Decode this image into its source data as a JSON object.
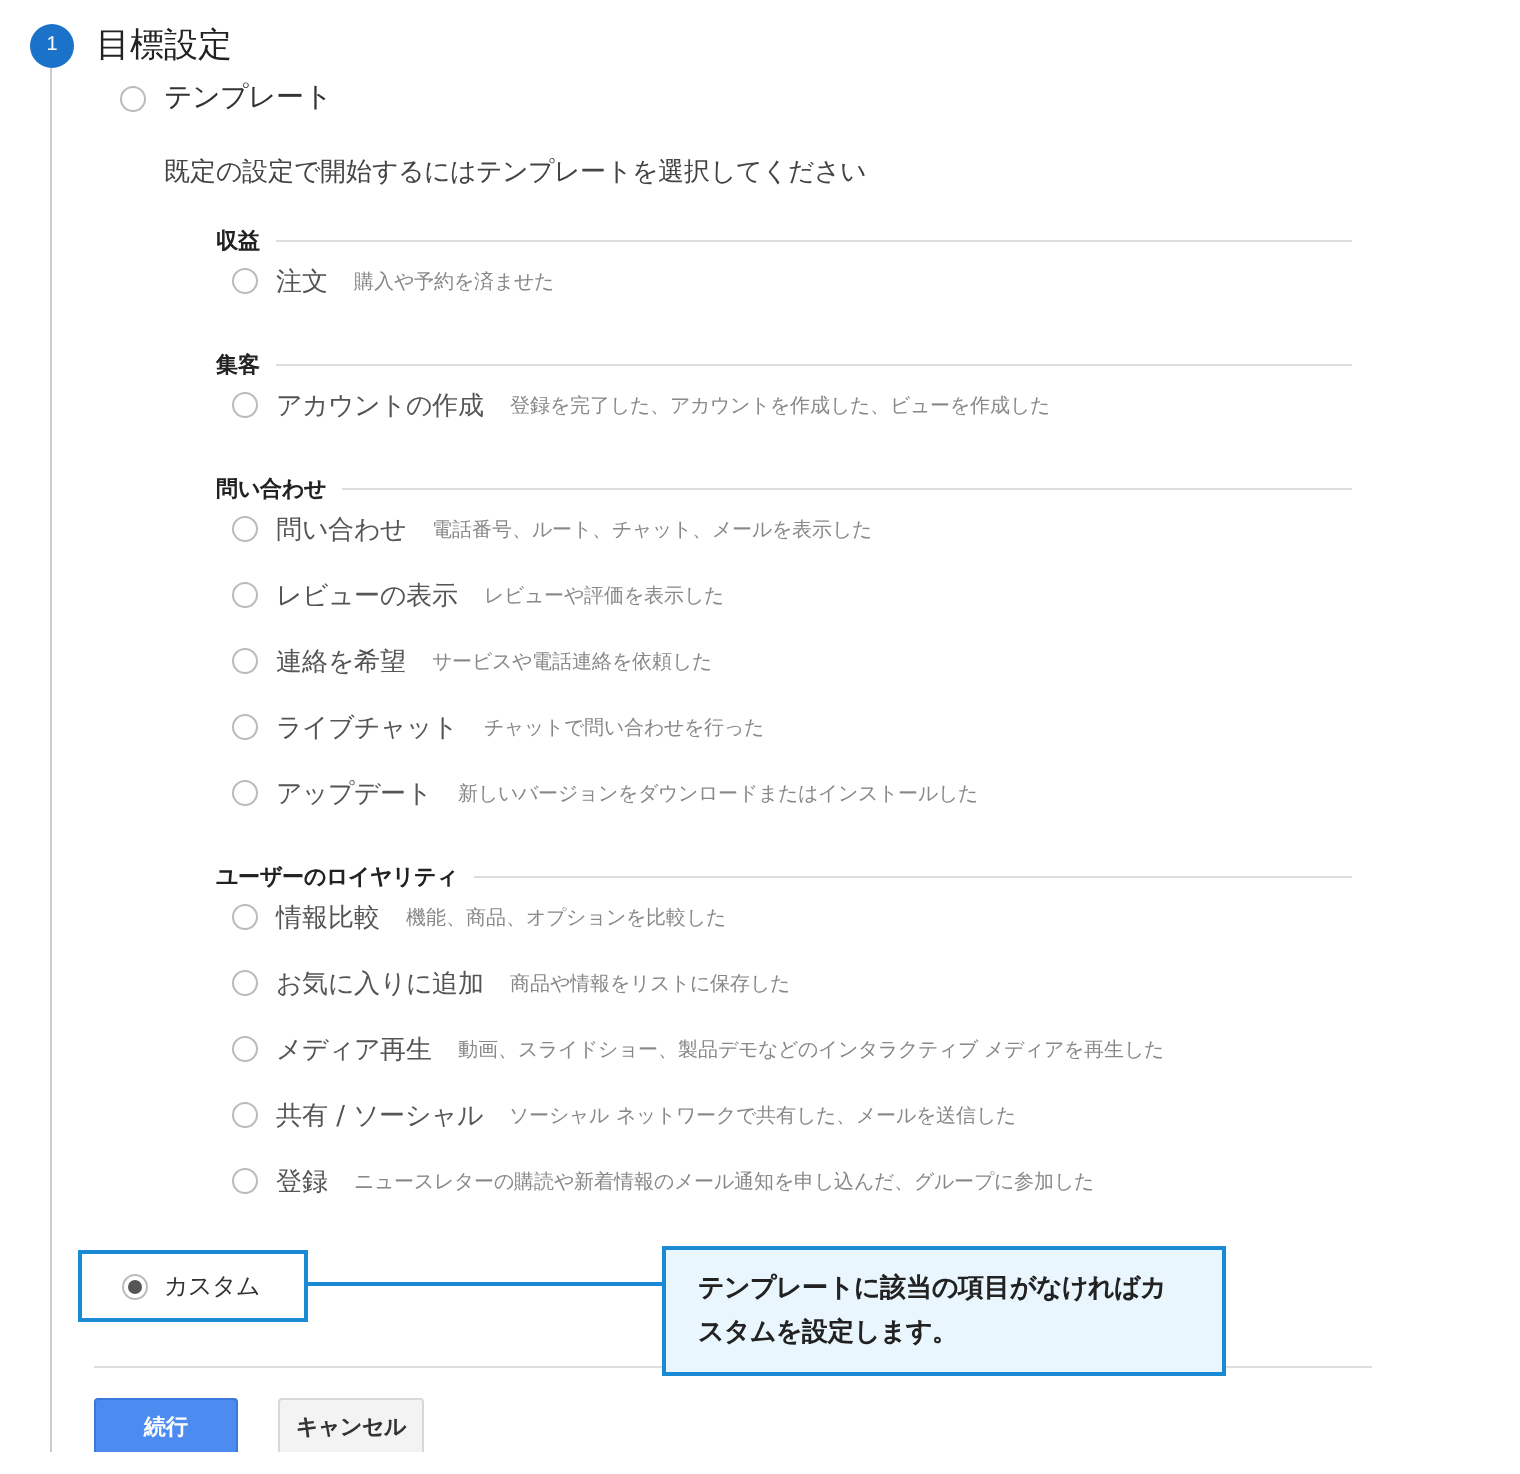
{
  "step": {
    "number": "1",
    "title": "目標設定"
  },
  "template_option": {
    "label": "テンプレート",
    "selected": false
  },
  "description": "既定の設定で開始するにはテンプレートを選択してください",
  "groups": [
    {
      "heading": "収益",
      "items": [
        {
          "label": "注文",
          "description": "購入や予約を済ませた",
          "selected": false
        }
      ]
    },
    {
      "heading": "集客",
      "items": [
        {
          "label": "アカウントの作成",
          "description": "登録を完了した、アカウントを作成した、ビューを作成した",
          "selected": false
        }
      ]
    },
    {
      "heading": "問い合わせ",
      "items": [
        {
          "label": "問い合わせ",
          "description": "電話番号、ルート、チャット、メールを表示した",
          "selected": false
        },
        {
          "label": "レビューの表示",
          "description": "レビューや評価を表示した",
          "selected": false
        },
        {
          "label": "連絡を希望",
          "description": "サービスや電話連絡を依頼した",
          "selected": false
        },
        {
          "label": "ライブチャット",
          "description": "チャットで問い合わせを行った",
          "selected": false
        },
        {
          "label": "アップデート",
          "description": "新しいバージョンをダウンロードまたはインストールした",
          "selected": false
        }
      ]
    },
    {
      "heading": "ユーザーのロイヤリティ",
      "items": [
        {
          "label": "情報比較",
          "description": "機能、商品、オプションを比較した",
          "selected": false
        },
        {
          "label": "お気に入りに追加",
          "description": "商品や情報をリストに保存した",
          "selected": false
        },
        {
          "label": "メディア再生",
          "description": "動画、スライドショー、製品デモなどのインタラクティブ メディアを再生した",
          "selected": false
        },
        {
          "label": "共有 / ソーシャル",
          "description": "ソーシャル ネットワークで共有した、メールを送信した",
          "selected": false
        },
        {
          "label": "登録",
          "description": "ニュースレターの購読や新着情報のメール通知を申し込んだ、グループに参加した",
          "selected": false
        }
      ]
    }
  ],
  "custom_option": {
    "label": "カスタム",
    "selected": true
  },
  "callout": "テンプレートに該当の項目がなければカスタムを設定します。",
  "buttons": [
    {
      "label": "続行",
      "kind": "primary"
    },
    {
      "label": "キャンセル",
      "kind": "secondary"
    }
  ]
}
